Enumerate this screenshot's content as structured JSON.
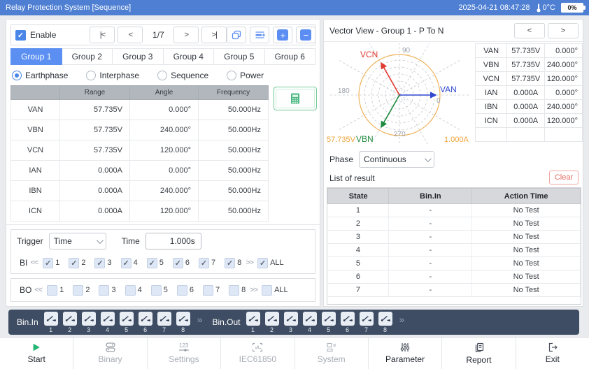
{
  "titlebar": {
    "title": "Relay Protection System [Sequence]",
    "datetime": "2025-04-21 08:47:28",
    "temperature": "0°C",
    "battery": "0%"
  },
  "left": {
    "enable_label": "Enable",
    "pager": {
      "first": "|<",
      "prev": "<",
      "page": "1/7",
      "next": ">",
      "last": ">|"
    },
    "tabs": [
      {
        "label": "Group 1",
        "active": true
      },
      {
        "label": "Group 2",
        "active": false
      },
      {
        "label": "Group 3",
        "active": false
      },
      {
        "label": "Group 4",
        "active": false
      },
      {
        "label": "Group 5",
        "active": false
      },
      {
        "label": "Group 6",
        "active": false
      }
    ],
    "modes": [
      {
        "label": "Earthphase",
        "selected": true
      },
      {
        "label": "Interphase",
        "selected": false
      },
      {
        "label": "Sequence",
        "selected": false
      },
      {
        "label": "Power",
        "selected": false
      }
    ],
    "channel_table": {
      "headers": {
        "name": "",
        "range": "Range",
        "angle": "Angle",
        "frequency": "Frequency"
      },
      "rows": [
        {
          "name": "VAN",
          "range": "57.735V",
          "angle": "0.000°",
          "freq": "50.000Hz"
        },
        {
          "name": "VBN",
          "range": "57.735V",
          "angle": "240.000°",
          "freq": "50.000Hz"
        },
        {
          "name": "VCN",
          "range": "57.735V",
          "angle": "120.000°",
          "freq": "50.000Hz"
        },
        {
          "name": "IAN",
          "range": "0.000A",
          "angle": "0.000°",
          "freq": "50.000Hz"
        },
        {
          "name": "IBN",
          "range": "0.000A",
          "angle": "240.000°",
          "freq": "50.000Hz"
        },
        {
          "name": "ICN",
          "range": "0.000A",
          "angle": "120.000°",
          "freq": "50.000Hz"
        }
      ]
    },
    "trigger": {
      "label": "Trigger",
      "type_value": "Time",
      "time_label": "Time",
      "time_value": "1.000s"
    },
    "bi": {
      "label": "BI",
      "in_arrow": "<<",
      "out_arrow": ">>",
      "all_label": "ALL",
      "channels": [
        "1",
        "2",
        "3",
        "4",
        "5",
        "6",
        "7",
        "8"
      ],
      "all_checked": true
    },
    "bo": {
      "label": "BO",
      "in_arrow": "<<",
      "out_arrow": ">>",
      "all_label": "ALL",
      "channels": [
        "1",
        "2",
        "3",
        "4",
        "5",
        "6",
        "7",
        "8"
      ],
      "all_checked": false
    }
  },
  "right": {
    "vector": {
      "title": "Vector View - Group 1 - P To N",
      "prev": "<",
      "next": ">",
      "axis_labels": {
        "top": "90",
        "left": "180",
        "bottom": "270",
        "right": "0"
      },
      "voltage_scale": "57.735V",
      "current_scale": "1.000A",
      "phasors": [
        {
          "name": "VAN",
          "angle_deg": 0,
          "color": "#2f49d1"
        },
        {
          "name": "VCN",
          "angle_deg": 120,
          "color": "#e03a30"
        },
        {
          "name": "VBN",
          "angle_deg": 240,
          "color": "#1f8a3e"
        }
      ]
    },
    "values_table": {
      "rows": [
        {
          "name": "VAN",
          "mag": "57.735V",
          "angle": "0.000°"
        },
        {
          "name": "VBN",
          "mag": "57.735V",
          "angle": "240.000°"
        },
        {
          "name": "VCN",
          "mag": "57.735V",
          "angle": "120.000°"
        },
        {
          "name": "IAN",
          "mag": "0.000A",
          "angle": "0.000°"
        },
        {
          "name": "IBN",
          "mag": "0.000A",
          "angle": "240.000°"
        },
        {
          "name": "ICN",
          "mag": "0.000A",
          "angle": "120.000°"
        },
        {
          "name": "",
          "mag": "",
          "angle": ""
        }
      ]
    },
    "phase": {
      "label": "Phase",
      "value": "Continuous"
    },
    "result": {
      "title": "List of result",
      "clear_label": "Clear",
      "headers": {
        "state": "State",
        "bin_in": "Bin.In",
        "action_time": "Action Time"
      },
      "rows": [
        {
          "state": "1",
          "bin_in": "-",
          "action_time": "No Test"
        },
        {
          "state": "2",
          "bin_in": "-",
          "action_time": "No Test"
        },
        {
          "state": "3",
          "bin_in": "-",
          "action_time": "No Test"
        },
        {
          "state": "4",
          "bin_in": "-",
          "action_time": "No Test"
        },
        {
          "state": "5",
          "bin_in": "-",
          "action_time": "No Test"
        },
        {
          "state": "6",
          "bin_in": "-",
          "action_time": "No Test"
        },
        {
          "state": "7",
          "bin_in": "-",
          "action_time": "No Test"
        }
      ]
    }
  },
  "statusbar": {
    "bin_in_label": "Bin.In",
    "bin_out_label": "Bin.Out",
    "separator": "»",
    "bin_in_channels": [
      "1",
      "2",
      "3",
      "4",
      "5",
      "6",
      "7",
      "8"
    ],
    "bin_out_channels": [
      "1",
      "2",
      "3",
      "4",
      "5",
      "6",
      "7",
      "8"
    ]
  },
  "toolbar": {
    "items": [
      {
        "label": "Start"
      },
      {
        "label": "Binary"
      },
      {
        "label": "Settings"
      },
      {
        "label": "IEC61850"
      },
      {
        "label": "System"
      },
      {
        "label": "Parameter"
      },
      {
        "label": "Report"
      },
      {
        "label": "Exit"
      }
    ]
  },
  "colors": {
    "titlebar": "#4e7fd3",
    "accent": "#5b8ff2",
    "statusbar_bg": "#3e4d63",
    "start_green": "#21b573",
    "van_blue": "#2f49d1",
    "vcn_red": "#e03a30",
    "vbn_green": "#1f8a3e",
    "scale_orange": "#f0a43c",
    "clear_red": "#e26d60"
  }
}
